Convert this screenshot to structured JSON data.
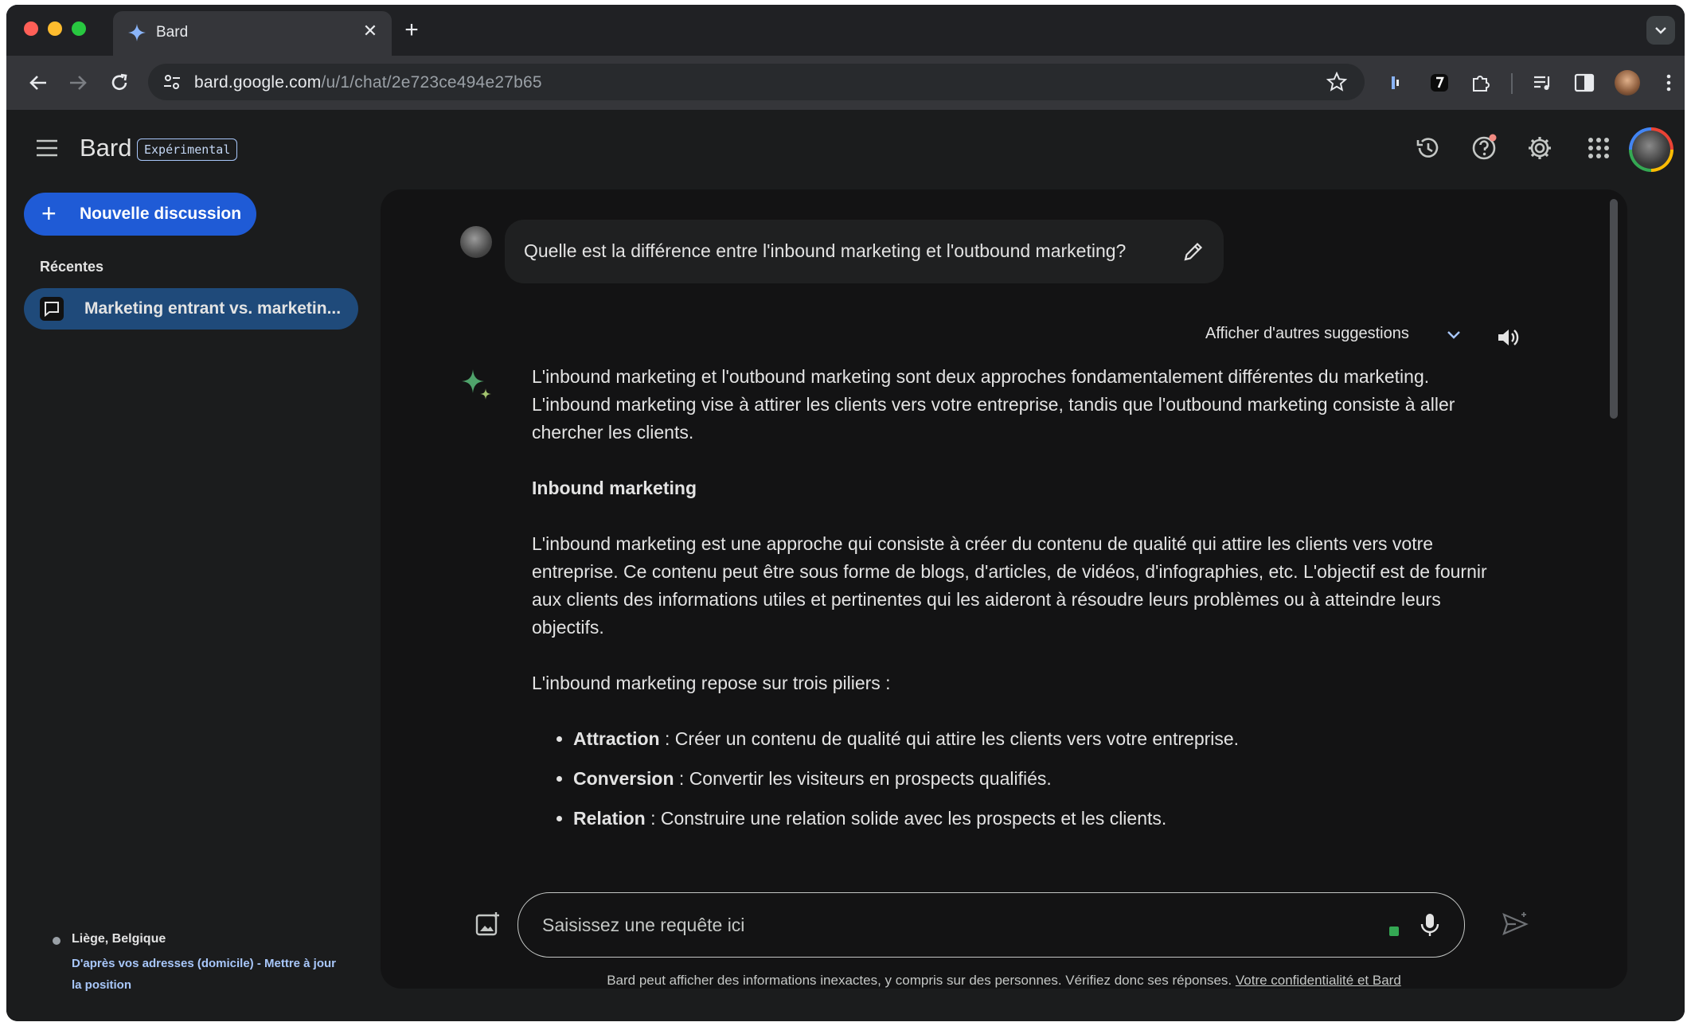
{
  "browser": {
    "tab_title": "Bard",
    "url_host": "bard.google.com",
    "url_path": "/u/1/chat/2e723ce494e27b65"
  },
  "app": {
    "brand": "Bard",
    "badge": "Expérimental",
    "new_chat_label": "Nouvelle discussion",
    "recent_title": "Récentes",
    "recent_items": [
      {
        "label": "Marketing entrant vs. marketin..."
      }
    ],
    "location": {
      "city": "Liège, Belgique",
      "source": "D'après vos adresses (domicile) - ",
      "update_link": "Mettre à jour la position"
    }
  },
  "chat": {
    "query": "Quelle est la différence entre l'inbound marketing et l'outbound marketing?",
    "drafts_label": "Afficher d'autres suggestions",
    "answer": {
      "intro": "L'inbound marketing et l'outbound marketing sont deux approches fondamentalement différentes du marketing. L'inbound marketing vise à attirer les clients vers votre entreprise, tandis que l'outbound marketing consiste à aller chercher les clients.",
      "heading": "Inbound marketing",
      "paragraph": "L'inbound marketing est une approche qui consiste à créer du contenu de qualité qui attire les clients vers votre entreprise. Ce contenu peut être sous forme de blogs, d'articles, de vidéos, d'infographies, etc. L'objectif est de fournir aux clients des informations utiles et pertinentes qui les aideront à résoudre leurs problèmes ou à atteindre leurs objectifs.",
      "pillars_intro": "L'inbound marketing repose sur trois piliers :",
      "pillars": [
        {
          "term": "Attraction",
          "text": " : Créer un contenu de qualité qui attire les clients vers votre entreprise."
        },
        {
          "term": "Conversion",
          "text": " : Convertir les visiteurs en prospects qualifiés."
        },
        {
          "term": "Relation",
          "text": " : Construire une relation solide avec les prospects et les clients."
        }
      ]
    },
    "input_placeholder": "Saisissez une requête ici",
    "disclaimer": "Bard peut afficher des informations inexactes, y compris sur des personnes. Vérifiez donc ses réponses. ",
    "disclaimer_link": "Votre confidentialité et Bard"
  },
  "colors": {
    "accent_blue": "#1f5bd6",
    "selected_item": "#1f4a7a",
    "panel_bg": "#131314",
    "page_bg": "#1b1c1d",
    "link": "#a8c7fa"
  }
}
